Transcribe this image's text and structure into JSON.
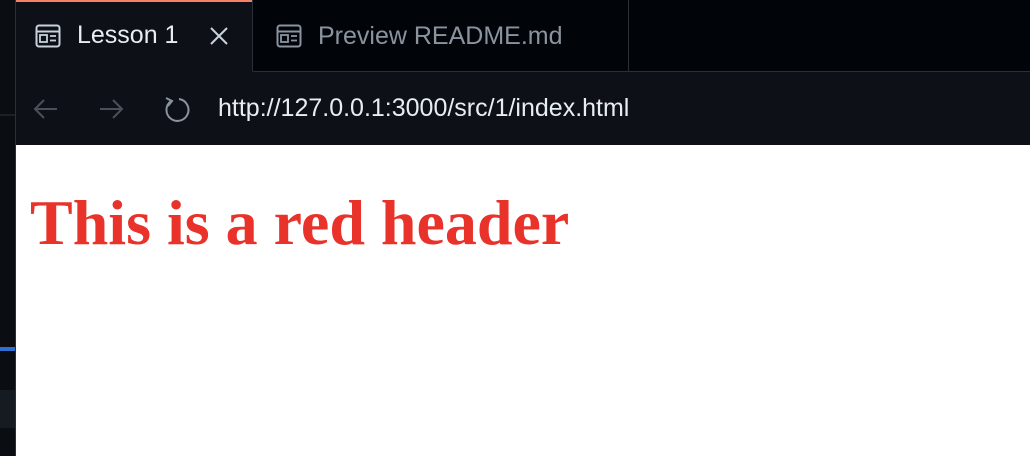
{
  "tabs": [
    {
      "label": "Lesson 1",
      "active": true,
      "icon": "preview-icon",
      "closable": true
    },
    {
      "label": "Preview README.md",
      "active": false,
      "icon": "preview-icon",
      "closable": false
    }
  ],
  "navigation": {
    "back_icon": "arrow-left-icon",
    "forward_icon": "arrow-right-icon",
    "reload_icon": "reload-icon",
    "url": "http://127.0.0.1:3000/src/1/index.html"
  },
  "page": {
    "heading": "This is a red header",
    "heading_color": "#e8322a"
  },
  "colors": {
    "tabbar_bg": "#010409",
    "active_tab_bg": "#0d1117",
    "active_tab_accent": "#f78166",
    "text_primary": "#e6edf3",
    "text_muted": "#8b949e"
  }
}
